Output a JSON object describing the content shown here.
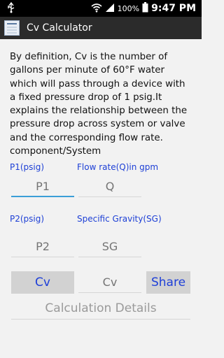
{
  "status_bar": {
    "battery": "100%",
    "time": "9:47 PM"
  },
  "action_bar": {
    "title": "Cv Calculator"
  },
  "description": "By definition, Cv is the number of gallons per minute of 60°F water which will pass through a device with a fixed pressure drop of 1 psig.It explains the relationship between the pressure drop across system or valve and the corresponding flow rate. component/System",
  "form": {
    "p1_label": "P1(psig)",
    "flow_label": "Flow rate(Q)in gpm",
    "p1_placeholder": "P1",
    "q_placeholder": "Q",
    "p2_label": "P2(psig)",
    "sg_label": "Specific Gravity(SG)",
    "p2_placeholder": "P2",
    "sg_placeholder": "SG",
    "cv_button": "Cv",
    "cv_result_placeholder": "Cv",
    "share_button": "Share",
    "details_button": "Calculation Details"
  },
  "colors": {
    "label_blue": "#1e40d6",
    "focus_underline": "#3b9ed8"
  }
}
